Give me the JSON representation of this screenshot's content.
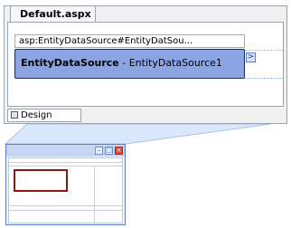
{
  "document": {
    "tab_title": "Default.aspx",
    "header_text": "asp:EntityDataSource#EntityDatSou...",
    "control_type": "EntityDataSource",
    "control_separator": " - ",
    "control_name": "EntityDataSource1",
    "smart_tag_glyph": ">",
    "design_tab_label": "Design"
  },
  "thumbnail": {
    "buttons": [
      "minimize",
      "maximize",
      "close"
    ]
  },
  "colors": {
    "control_fill": "#8ba5e4",
    "control_border": "#1b2c57",
    "callout_fill": "#dbe8fb",
    "thumbnail_highlight": "#8b1a13",
    "close_button": "#e04b3c"
  }
}
